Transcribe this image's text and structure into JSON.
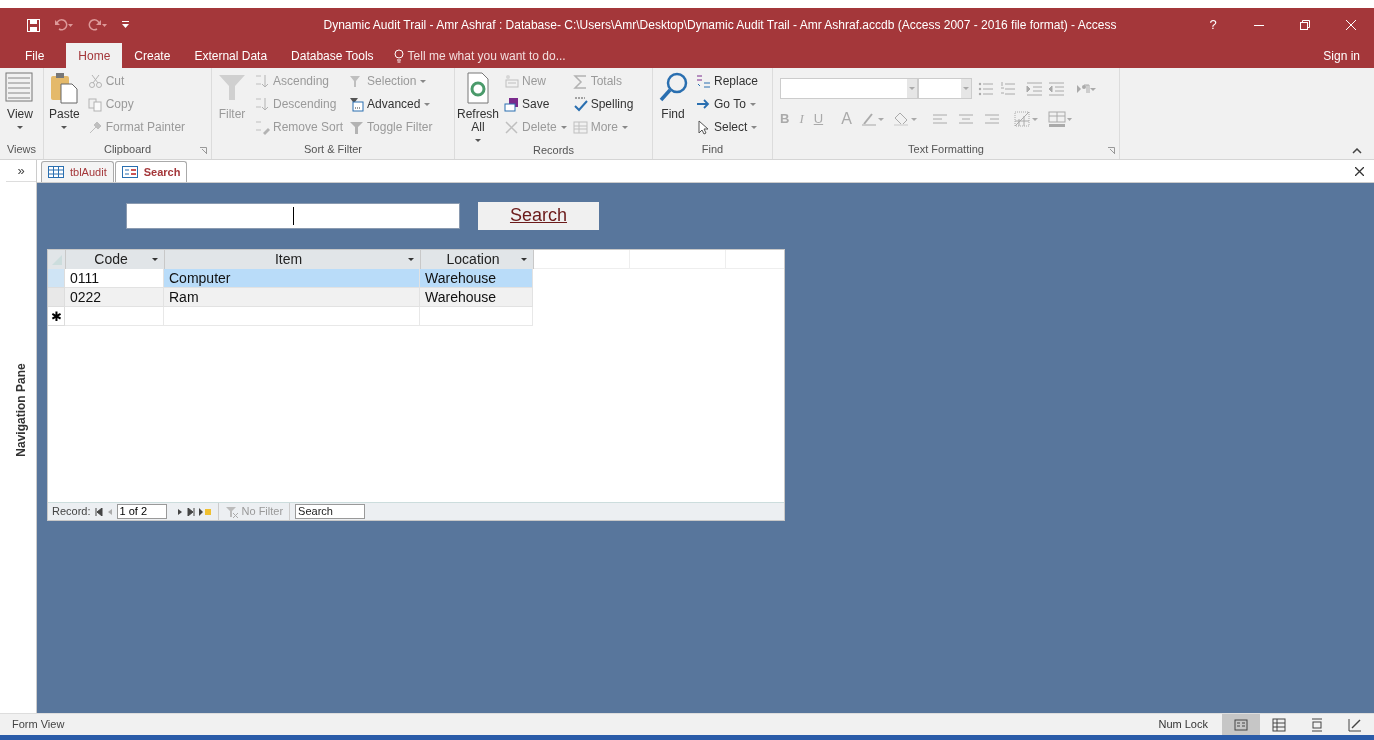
{
  "window": {
    "title": "Dynamic Audit Trail - Amr Ashraf : Database- C:\\Users\\Amr\\Desktop\\Dynamic Audit Trail - Amr Ashraf.accdb (Access 2007 - 2016 file format) - Access",
    "help": "?",
    "sign_in": "Sign in"
  },
  "menu_tabs": [
    {
      "label": "File",
      "selected": false
    },
    {
      "label": "Home",
      "selected": true
    },
    {
      "label": "Create",
      "selected": false
    },
    {
      "label": "External Data",
      "selected": false
    },
    {
      "label": "Database Tools",
      "selected": false
    }
  ],
  "tell_me": "Tell me what you want to do...",
  "ribbon": [
    {
      "label": "Views",
      "commands": [
        {
          "label": "View",
          "kind": "large",
          "disabled": false,
          "dropdown": true
        }
      ]
    },
    {
      "label": "Clipboard",
      "commands": [
        {
          "label": "Paste",
          "kind": "large",
          "disabled": false,
          "dropdown": true
        },
        {
          "label": "Cut",
          "kind": "small",
          "disabled": true,
          "dropdown": false
        },
        {
          "label": "Copy",
          "kind": "small",
          "disabled": true,
          "dropdown": false
        },
        {
          "label": "Format Painter",
          "kind": "small",
          "disabled": true,
          "dropdown": false
        }
      ]
    },
    {
      "label": "Sort & Filter",
      "commands": [
        {
          "label": "Filter",
          "kind": "large",
          "disabled": true,
          "dropdown": false
        },
        {
          "label": "Ascending",
          "kind": "small",
          "disabled": true,
          "dropdown": false
        },
        {
          "label": "Descending",
          "kind": "small",
          "disabled": true,
          "dropdown": false
        },
        {
          "label": "Remove Sort",
          "kind": "small",
          "disabled": true,
          "dropdown": false
        },
        {
          "label": "Selection",
          "kind": "small",
          "disabled": true,
          "dropdown": true
        },
        {
          "label": "Advanced",
          "kind": "small",
          "disabled": false,
          "dropdown": true
        },
        {
          "label": "Toggle Filter",
          "kind": "small",
          "disabled": true,
          "dropdown": false
        }
      ]
    },
    {
      "label": "Records",
      "commands": [
        {
          "label": "Refresh All",
          "kind": "large",
          "disabled": false,
          "dropdown": true
        },
        {
          "label": "New",
          "kind": "small",
          "disabled": true,
          "dropdown": false
        },
        {
          "label": "Save",
          "kind": "small",
          "disabled": false,
          "dropdown": false
        },
        {
          "label": "Delete",
          "kind": "small",
          "disabled": true,
          "dropdown": true
        },
        {
          "label": "Totals",
          "kind": "small",
          "disabled": true,
          "dropdown": false
        },
        {
          "label": "Spelling",
          "kind": "small",
          "disabled": false,
          "dropdown": false
        },
        {
          "label": "More",
          "kind": "small",
          "disabled": true,
          "dropdown": true
        }
      ]
    },
    {
      "label": "Find",
      "commands": [
        {
          "label": "Find",
          "kind": "large",
          "disabled": false,
          "dropdown": false
        },
        {
          "label": "Replace",
          "kind": "small",
          "disabled": false,
          "dropdown": false
        },
        {
          "label": "Go To",
          "kind": "small",
          "disabled": false,
          "dropdown": true
        },
        {
          "label": "Select",
          "kind": "small",
          "disabled": false,
          "dropdown": true
        }
      ]
    },
    {
      "label": "Text Formatting"
    }
  ],
  "format_glyphs": [
    "B",
    "I",
    "U",
    "A"
  ],
  "nav_pane": {
    "toggle": "»",
    "label": "Navigation Pane"
  },
  "doc_tabs": [
    {
      "label": "tblAudit",
      "kind": "table",
      "selected": false
    },
    {
      "label": "Search",
      "kind": "form",
      "selected": true
    }
  ],
  "form": {
    "search_button": "Search",
    "datasheet": {
      "columns": [
        "Code",
        "Item",
        "Location"
      ],
      "rows": [
        {
          "cells": [
            "0111",
            "Computer",
            "Warehouse"
          ],
          "selected": true
        },
        {
          "cells": [
            "0222",
            "Ram",
            "Warehouse"
          ],
          "selected": false
        }
      ],
      "new_row_marker": "✱"
    },
    "record_nav": {
      "label": "Record:",
      "position": "1 of 2",
      "filter": "No Filter",
      "search_placeholder": "Search"
    }
  },
  "status_bar": {
    "view": "Form View",
    "num_lock": "Num Lock",
    "views": [
      {
        "kind": "form",
        "selected": true
      },
      {
        "kind": "datasheet",
        "selected": false
      },
      {
        "kind": "layout",
        "selected": false
      },
      {
        "kind": "design",
        "selected": false
      }
    ]
  }
}
